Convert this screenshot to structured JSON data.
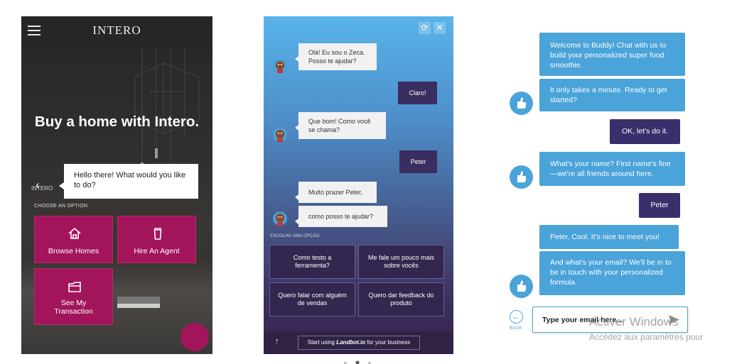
{
  "intero": {
    "brand": "INTERO",
    "headline": "Buy a home with Intero.",
    "bubble_text": "Hello there! What would you like to do?",
    "watermark": "INTERO",
    "choose_label": "CHOOSE AN OPTION",
    "options": [
      {
        "label": "Browse Homes",
        "icon": "house-icon"
      },
      {
        "label": "Hire An Agent",
        "icon": "cup-icon"
      },
      {
        "label": "See My Transaction",
        "icon": "folder-icon"
      }
    ],
    "accent_color": "#a3155a"
  },
  "landbot": {
    "bot_messages": [
      "Olá! Eu sou o Zeca. Posso te ajudar?",
      "Que bom! Como você se chama?",
      "Muito prazer Peter,",
      "como posso te ajudar?"
    ],
    "user_messages": [
      "Claro!",
      "Peter"
    ],
    "choose_label": "ESCOLHA UMA OPÇÃO",
    "options": [
      "Como testo a ferramenta?",
      "Me fale um pouco mais sobre vocês",
      "Quero falar com alguém de vendas",
      "Quero dar feedback do produto"
    ],
    "footer_prefix": "Start using ",
    "footer_brand": "Landbot.io",
    "footer_suffix": " for your business"
  },
  "buddy": {
    "bot_messages": [
      "Welcome to Buddy! Chat with us to build your personalized super food smoothie.",
      "It only takes a minute. Ready to get started?",
      "What's your name? First name's fine—we're all friends around here.",
      "Peter. Cool. It's nice to meet you!",
      "And what's your email? We'll be in to be in touch with your personalized formula."
    ],
    "user_messages": [
      "OK, let's do it.",
      "Peter"
    ],
    "back_label": "BACK",
    "input_value": "Type your email here...",
    "accent_color": "#4aa3d9",
    "user_color": "#3a2f6b"
  },
  "windows_watermark": {
    "line1": "Activer Windows",
    "line2": "Accédez aux paramètres pour"
  }
}
